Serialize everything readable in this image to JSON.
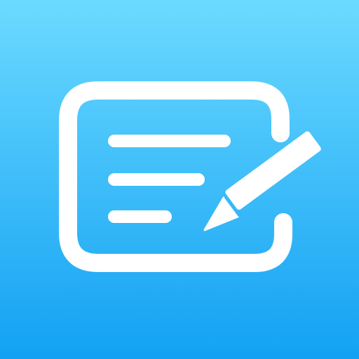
{
  "icon": {
    "name": "notes-with-pencil-icon",
    "background_top_color": "#6CDAFF",
    "background_bottom_color": "#12A1F3",
    "glyph_color": "#FFFFFF"
  }
}
